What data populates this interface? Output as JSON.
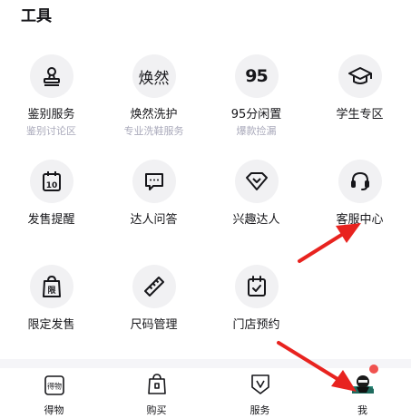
{
  "section_title": "工具",
  "tools": [
    {
      "label": "鉴别服务",
      "sub": "鉴别讨论区",
      "icon": "identify-stamp-icon"
    },
    {
      "label": "焕然洗护",
      "sub": "专业洗鞋服务",
      "icon": "huanran-text-icon",
      "glyph": "焕然"
    },
    {
      "label": "95分闲置",
      "sub": "爆款捡漏",
      "icon": "95-logo-icon",
      "glyph": "95"
    },
    {
      "label": "学生专区",
      "sub": "",
      "icon": "graduation-cap-icon"
    },
    {
      "label": "发售提醒",
      "sub": "",
      "icon": "calendar-10-icon",
      "glyph": "10"
    },
    {
      "label": "达人问答",
      "sub": "",
      "icon": "chat-bubble-icon"
    },
    {
      "label": "兴趣达人",
      "sub": "",
      "icon": "diamond-icon"
    },
    {
      "label": "客服中心",
      "sub": "",
      "icon": "headset-icon"
    },
    {
      "label": "限定发售",
      "sub": "",
      "icon": "limited-bag-icon",
      "glyph": "限"
    },
    {
      "label": "尺码管理",
      "sub": "",
      "icon": "ruler-icon"
    },
    {
      "label": "门店预约",
      "sub": "",
      "icon": "calendar-check-icon"
    }
  ],
  "tabbar": [
    {
      "label": "得物",
      "icon": "dewu-logo-icon",
      "glyph": "得物"
    },
    {
      "label": "购买",
      "icon": "shopping-bag-icon"
    },
    {
      "label": "服务",
      "icon": "shield-v-icon"
    },
    {
      "label": "我",
      "icon": "avatar-icon"
    }
  ],
  "colors": {
    "icon_bg": "#f1f1f3",
    "text": "#16161a",
    "subtext": "#aaaabb",
    "annotation_arrow": "#e8231f",
    "badge": "#f0524f"
  }
}
